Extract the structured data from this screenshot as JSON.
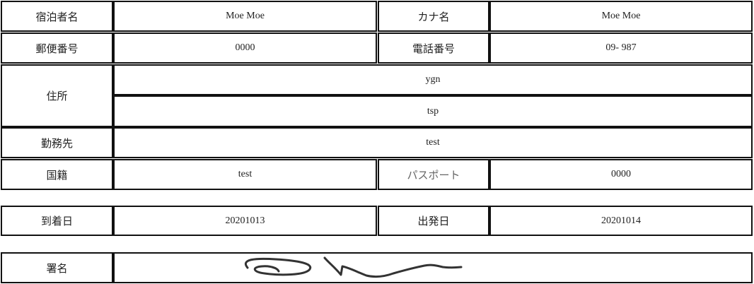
{
  "guest_name_label": "宿泊者名",
  "guest_name": "Moe Moe",
  "kana_name_label": "カナ名",
  "kana_name": "Moe Moe",
  "postal_code_label": "郵便番号",
  "postal_code": "0000",
  "phone_label": "電話番号",
  "phone": "09- 987",
  "address_label": "住所",
  "address_line1": "ygn",
  "address_line2": "tsp",
  "workplace_label": "勤務先",
  "workplace": "test",
  "nationality_label": "国籍",
  "nationality": "test",
  "passport_label": "パスポート",
  "passport": "0000",
  "arrival_label": "到着日",
  "arrival_date": "20201013",
  "departure_label": "出発日",
  "departure_date": "20201014",
  "signature_label": "署名"
}
